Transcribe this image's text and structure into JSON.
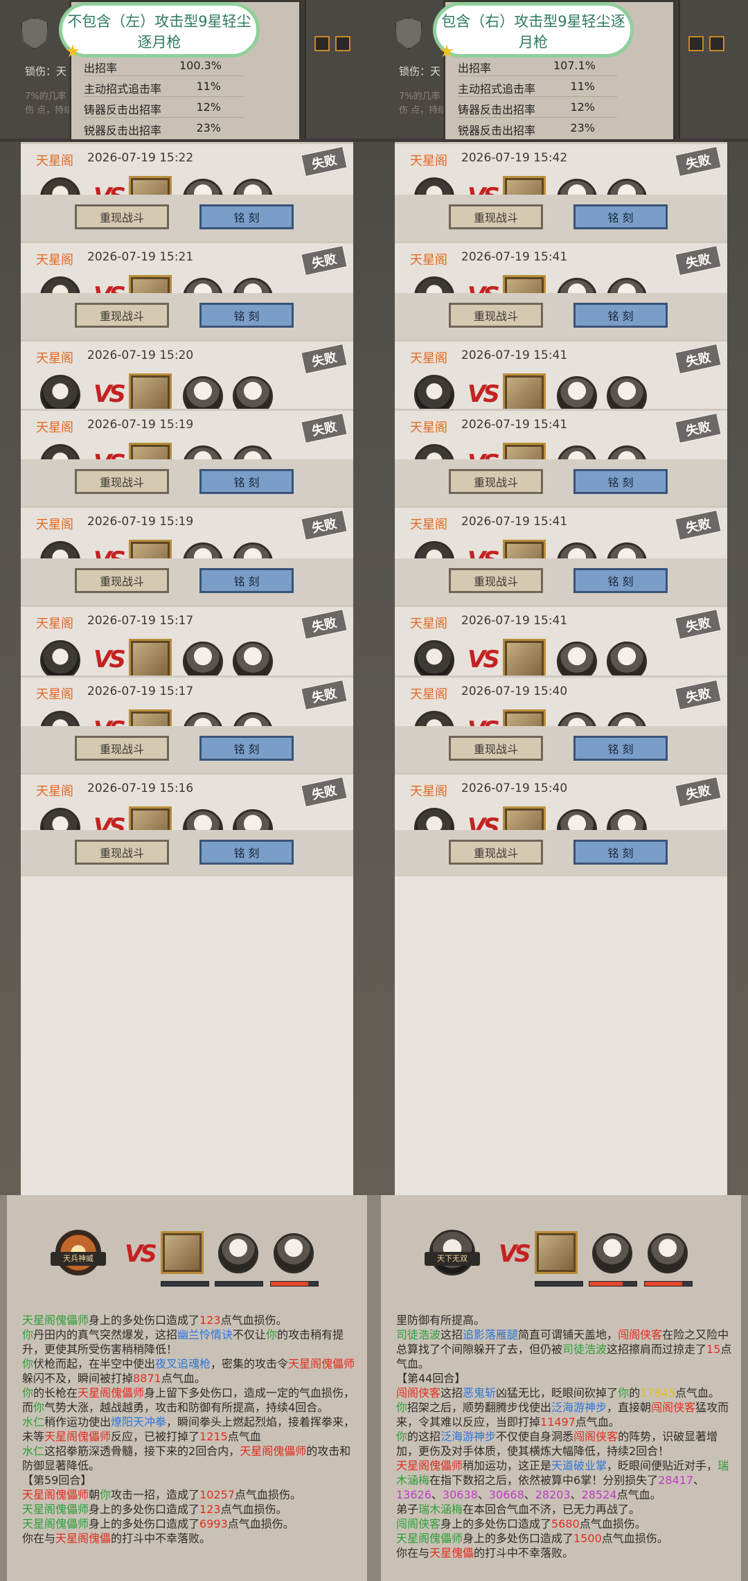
{
  "left": {
    "bubble_text": "不包含（左）攻击型9星轻尘逐月枪",
    "stats": [
      {
        "label": "出招率",
        "value": "100.3%"
      },
      {
        "label": "主动招式追击率",
        "value": "11%"
      },
      {
        "label": "铸器反击出招率",
        "value": "12%"
      },
      {
        "label": "锐器反击出招率",
        "value": "23%"
      }
    ],
    "card_tag": "锁伤：天",
    "card_faint": "7%的几率 反击伤 点，持续",
    "records": [
      {
        "guild": "天星阁",
        "time": "2026-07-19 15:22",
        "result": "失败"
      },
      {
        "guild": "天星阁",
        "time": "2026-07-19 15:21",
        "result": "失败"
      },
      {
        "guild": "天星阁",
        "time": "2026-07-19 15:20",
        "result": "失败"
      },
      {
        "guild": "天星阁",
        "time": "2026-07-19 15:19",
        "result": "失败"
      },
      {
        "guild": "天星阁",
        "time": "2026-07-19 15:19",
        "result": "失败"
      },
      {
        "guild": "天星阁",
        "time": "2026-07-19 15:17",
        "result": "失败"
      },
      {
        "guild": "天星阁",
        "time": "2026-07-19 15:17",
        "result": "失败"
      },
      {
        "guild": "天星阁",
        "time": "2026-07-19 15:16",
        "result": "失败"
      }
    ],
    "btn_replay": "重现战斗",
    "btn_engrave": "铭 刻",
    "bottom_tag": "天兵神威",
    "log_lines": [
      [
        {
          "t": "天星阁傀儡师",
          "c": "g"
        },
        {
          "t": "身上的多处伤口造成了"
        },
        {
          "t": "123",
          "c": "r"
        },
        {
          "t": "点气血损伤。"
        }
      ],
      [
        {
          "t": "你",
          "c": "g"
        },
        {
          "t": "丹田内的真气突然爆发，这招"
        },
        {
          "t": "幽兰怜情诀",
          "c": "b"
        },
        {
          "t": "不仅让"
        },
        {
          "t": "你",
          "c": "g"
        },
        {
          "t": "的攻击稍有提升，更使其所受伤害稍稍降低！"
        }
      ],
      [
        {
          "t": "你",
          "c": "g"
        },
        {
          "t": "伏枪而起，在半空中使出"
        },
        {
          "t": "夜叉追魂枪",
          "c": "b"
        },
        {
          "t": "，密集的攻击令"
        },
        {
          "t": "天星阁傀儡师",
          "c": "r"
        },
        {
          "t": "躲闪不及，瞬间被打掉"
        },
        {
          "t": "8871",
          "c": "r"
        },
        {
          "t": "点气血。"
        }
      ],
      [
        {
          "t": "你",
          "c": "g"
        },
        {
          "t": "的长枪在"
        },
        {
          "t": "天星阁傀儡师",
          "c": "r"
        },
        {
          "t": "身上留下多处伤口，造成一定的气血损伤，而"
        },
        {
          "t": "你",
          "c": "g"
        },
        {
          "t": "气势大涨，越战越勇，攻击和防御有所提高，持续4回合。"
        }
      ],
      [
        {
          "t": "水仁",
          "c": "g"
        },
        {
          "t": "稍作运功使出"
        },
        {
          "t": "燎阳天冲拳",
          "c": "b"
        },
        {
          "t": "，瞬间拳头上燃起烈焰，接着挥拳来，未等"
        },
        {
          "t": "天星阁傀儡师",
          "c": "r"
        },
        {
          "t": "反应，已被打掉了"
        },
        {
          "t": "1215",
          "c": "r"
        },
        {
          "t": "点气血"
        }
      ],
      [
        {
          "t": "水仁",
          "c": "g"
        },
        {
          "t": "这招拳筋深透骨髓，接下来的2回合内，"
        },
        {
          "t": "天星阁傀儡师",
          "c": "r"
        },
        {
          "t": "的攻击和防御显著降低。"
        }
      ],
      [
        {
          "t": "【第59回合】"
        }
      ],
      [
        {
          "t": "天星阁傀儡师",
          "c": "r"
        },
        {
          "t": "朝"
        },
        {
          "t": "你",
          "c": "g"
        },
        {
          "t": "攻击一招，造成了"
        },
        {
          "t": "10257",
          "c": "r"
        },
        {
          "t": "点气血损伤。"
        }
      ],
      [
        {
          "t": "天星阁傀儡师",
          "c": "g"
        },
        {
          "t": "身上的多处伤口造成了"
        },
        {
          "t": "123",
          "c": "r"
        },
        {
          "t": "点气血损伤。"
        }
      ],
      [
        {
          "t": "天星阁傀儡师",
          "c": "g"
        },
        {
          "t": "身上的多处伤口造成了"
        },
        {
          "t": "6993",
          "c": "r"
        },
        {
          "t": "点气血损伤。"
        }
      ],
      [
        {
          "t": "你在与"
        },
        {
          "t": "天星阁傀儡",
          "c": "r"
        },
        {
          "t": "的打斗中不幸落败。"
        }
      ]
    ]
  },
  "right": {
    "bubble_text": "包含（右）攻击型9星轻尘逐月枪",
    "stats": [
      {
        "label": "出招率",
        "value": "107.1%"
      },
      {
        "label": "主动招式追击率",
        "value": "11%"
      },
      {
        "label": "铸器反击出招率",
        "value": "12%"
      },
      {
        "label": "锐器反击出招率",
        "value": "23%"
      }
    ],
    "card_tag": "锁伤：天",
    "card_faint": "7%的几率 反击伤 点，持续",
    "records": [
      {
        "guild": "天星阁",
        "time": "2026-07-19 15:42",
        "result": "失败"
      },
      {
        "guild": "天星阁",
        "time": "2026-07-19 15:41",
        "result": "失败"
      },
      {
        "guild": "天星阁",
        "time": "2026-07-19 15:41",
        "result": "失败"
      },
      {
        "guild": "天星阁",
        "time": "2026-07-19 15:41",
        "result": "失败"
      },
      {
        "guild": "天星阁",
        "time": "2026-07-19 15:41",
        "result": "失败"
      },
      {
        "guild": "天星阁",
        "time": "2026-07-19 15:41",
        "result": "失败"
      },
      {
        "guild": "天星阁",
        "time": "2026-07-19 15:40",
        "result": "失败"
      },
      {
        "guild": "天星阁",
        "time": "2026-07-19 15:40",
        "result": "失败"
      }
    ],
    "btn_replay": "重现战斗",
    "btn_engrave": "铭 刻",
    "bottom_tag": "天下无双",
    "log_lines": [
      [
        {
          "t": "里防御有所提高。"
        }
      ],
      [
        {
          "t": "司徒浩波",
          "c": "g"
        },
        {
          "t": "这招"
        },
        {
          "t": "追影落雁腿",
          "c": "b"
        },
        {
          "t": "简直可谓铺天盖地，"
        },
        {
          "t": "闯阁侠客",
          "c": "r"
        },
        {
          "t": "在险之又险中总算找了个间隙躲开了去，但仍被"
        },
        {
          "t": "司徒浩波",
          "c": "g"
        },
        {
          "t": "这招擦肩而过掠走了"
        },
        {
          "t": "15",
          "c": "r"
        },
        {
          "t": "点气血。"
        }
      ],
      [
        {
          "t": "【第44回合】"
        }
      ],
      [
        {
          "t": "闯阁侠客",
          "c": "r"
        },
        {
          "t": "这招"
        },
        {
          "t": "恶鬼斩",
          "c": "b"
        },
        {
          "t": "凶猛无比，眨眼间砍掉了"
        },
        {
          "t": "你",
          "c": "g"
        },
        {
          "t": "的"
        },
        {
          "t": "17845",
          "c": "y"
        },
        {
          "t": "点气血。"
        }
      ],
      [
        {
          "t": "你",
          "c": "g"
        },
        {
          "t": "招架之后，顺势翻腾步伐使出"
        },
        {
          "t": "泛海游神步",
          "c": "b"
        },
        {
          "t": "，直接朝"
        },
        {
          "t": "闯阁侠客",
          "c": "r"
        },
        {
          "t": "猛攻而来，令其难以反应，当即打掉"
        },
        {
          "t": "11497",
          "c": "r"
        },
        {
          "t": "点气血。"
        }
      ],
      [
        {
          "t": "你",
          "c": "g"
        },
        {
          "t": "的这招"
        },
        {
          "t": "泛海游神步",
          "c": "b"
        },
        {
          "t": "不仅使自身洞悉"
        },
        {
          "t": "闯阁侠客",
          "c": "r"
        },
        {
          "t": "的阵势，识破显著增加，更伤及对手体质，使其横炼大幅降低，持续2回合！"
        }
      ],
      [
        {
          "t": "天星阁傀儡师",
          "c": "r"
        },
        {
          "t": "稍加运功，这正是"
        },
        {
          "t": "天道破业掌",
          "c": "b"
        },
        {
          "t": "，眨眼间便贴近对手，"
        },
        {
          "t": "瑞木涵梅",
          "c": "g"
        },
        {
          "t": "在指下数招之后，依然被算中6掌！分别损失了"
        },
        {
          "t": "28417",
          "c": "p"
        },
        {
          "t": "、"
        },
        {
          "t": "13626",
          "c": "p"
        },
        {
          "t": "、"
        },
        {
          "t": "30638",
          "c": "p"
        },
        {
          "t": "、"
        },
        {
          "t": "30668",
          "c": "p"
        },
        {
          "t": "、"
        },
        {
          "t": "28203",
          "c": "p"
        },
        {
          "t": "、"
        },
        {
          "t": "28524",
          "c": "p"
        },
        {
          "t": "点气血。"
        }
      ],
      [
        {
          "t": "弟子"
        },
        {
          "t": "瑞木涵梅",
          "c": "g"
        },
        {
          "t": "在本回合气血不济，已无力再战了。"
        }
      ],
      [
        {
          "t": "闯阁侠客",
          "c": "g"
        },
        {
          "t": "身上的多处伤口造成了"
        },
        {
          "t": "5680",
          "c": "r"
        },
        {
          "t": "点气血损伤。"
        }
      ],
      [
        {
          "t": "天星阁傀儡师",
          "c": "g"
        },
        {
          "t": "身上的多处伤口造成了"
        },
        {
          "t": "1500",
          "c": "r"
        },
        {
          "t": "点气血损伤。"
        }
      ],
      [
        {
          "t": "你在与"
        },
        {
          "t": "天星傀儡",
          "c": "r"
        },
        {
          "t": "的打斗中不幸落败。"
        }
      ]
    ]
  },
  "colors": {
    "accent_orange": "#e26a25",
    "vs_red": "#c42222",
    "engrave_blue": "#7a9ec8",
    "replay_beige": "#d5c9b2",
    "bubble_green": "#8fd09a"
  },
  "icons": [
    "shield-icon",
    "fail-stamp-icon",
    "vs-icon",
    "boss-portrait-icon",
    "avatar-icon"
  ]
}
